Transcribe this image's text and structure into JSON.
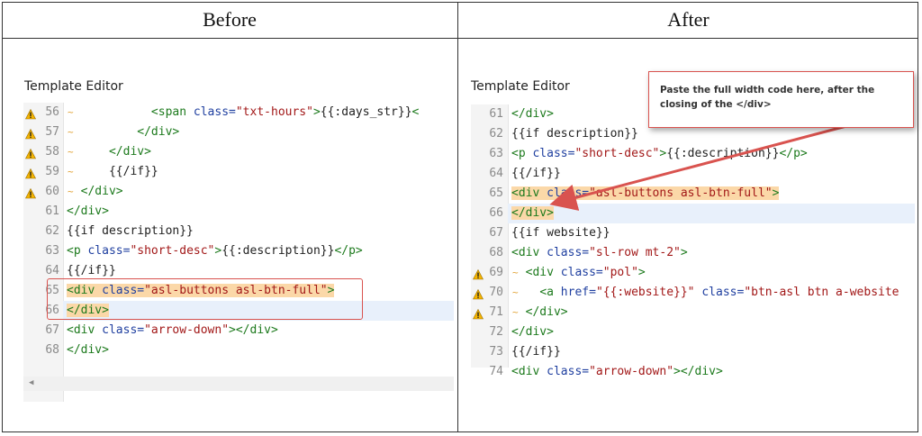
{
  "headers": {
    "before": "Before",
    "after": "After"
  },
  "before": {
    "title": "Template Editor",
    "lines": [
      {
        "num": "56",
        "warn": true,
        "segs": [
          [
            "",
            "            "
          ],
          [
            "tag",
            "<span "
          ],
          [
            "attr",
            "class="
          ],
          [
            "str",
            "\"txt-hours\""
          ],
          [
            "tag",
            ">"
          ],
          [
            "",
            "{{:days_str}}"
          ],
          [
            "tag",
            "<"
          ]
        ]
      },
      {
        "num": "57",
        "warn": true,
        "segs": [
          [
            "",
            "          "
          ],
          [
            "tag",
            "</div>"
          ]
        ]
      },
      {
        "num": "58",
        "warn": true,
        "segs": [
          [
            "",
            "      "
          ],
          [
            "tag",
            "</div>"
          ]
        ]
      },
      {
        "num": "59",
        "warn": true,
        "segs": [
          [
            "",
            "      {{/if}}"
          ]
        ]
      },
      {
        "num": "60",
        "warn": true,
        "segs": [
          [
            "",
            "  "
          ],
          [
            "tag",
            "</div>"
          ]
        ]
      },
      {
        "num": "61",
        "warn": false,
        "segs": [
          [
            "tag",
            "</div>"
          ]
        ]
      },
      {
        "num": "62",
        "warn": false,
        "segs": [
          [
            "",
            "{{if description}}"
          ]
        ]
      },
      {
        "num": "63",
        "warn": false,
        "segs": [
          [
            "tag",
            "<p "
          ],
          [
            "attr",
            "class="
          ],
          [
            "str",
            "\"short-desc\""
          ],
          [
            "tag",
            ">"
          ],
          [
            "",
            "{{:description}}"
          ],
          [
            "tag",
            "</p>"
          ]
        ]
      },
      {
        "num": "64",
        "warn": false,
        "segs": [
          [
            "",
            "{{/if}}"
          ]
        ]
      },
      {
        "num": "65",
        "warn": false,
        "mark": true,
        "segs": [
          [
            "tag",
            "<div "
          ],
          [
            "attr",
            "class="
          ],
          [
            "str",
            "\"asl-buttons asl-btn-full\""
          ],
          [
            "tag",
            ">"
          ]
        ]
      },
      {
        "num": "66",
        "warn": false,
        "mark": true,
        "active": true,
        "segs": [
          [
            "tag",
            "</div>"
          ]
        ]
      },
      {
        "num": "67",
        "warn": false,
        "segs": [
          [
            "tag",
            "<div "
          ],
          [
            "attr",
            "class="
          ],
          [
            "str",
            "\"arrow-down\""
          ],
          [
            "tag",
            "></div>"
          ]
        ]
      },
      {
        "num": "68",
        "warn": false,
        "segs": [
          [
            "tag",
            "</div>"
          ]
        ]
      }
    ]
  },
  "after": {
    "title": "Template Editor",
    "callout": "Paste the full width code here, after the closing of the </div>",
    "lines": [
      {
        "num": "61",
        "warn": false,
        "segs": [
          [
            "tag",
            "</div>"
          ]
        ]
      },
      {
        "num": "62",
        "warn": false,
        "segs": [
          [
            "",
            "{{if description}}"
          ]
        ]
      },
      {
        "num": "63",
        "warn": false,
        "segs": [
          [
            "tag",
            "<p "
          ],
          [
            "attr",
            "class="
          ],
          [
            "str",
            "\"short-desc\""
          ],
          [
            "tag",
            ">"
          ],
          [
            "",
            "{{:description}}"
          ],
          [
            "tag",
            "</p>"
          ]
        ]
      },
      {
        "num": "64",
        "warn": false,
        "segs": [
          [
            "",
            "{{/if}}"
          ]
        ]
      },
      {
        "num": "65",
        "warn": false,
        "mark": true,
        "segs": [
          [
            "tag",
            "<div "
          ],
          [
            "attr",
            "class="
          ],
          [
            "str",
            "\"asl-buttons asl-btn-full\""
          ],
          [
            "tag",
            ">"
          ]
        ]
      },
      {
        "num": "66",
        "warn": false,
        "mark": true,
        "active": true,
        "segs": [
          [
            "tag",
            "</div>"
          ]
        ]
      },
      {
        "num": "67",
        "warn": false,
        "segs": [
          [
            "",
            "{{if website}}"
          ]
        ]
      },
      {
        "num": "68",
        "warn": false,
        "segs": [
          [
            "tag",
            "<div "
          ],
          [
            "attr",
            "class="
          ],
          [
            "str",
            "\"sl-row mt-2\""
          ],
          [
            "tag",
            ">"
          ]
        ]
      },
      {
        "num": "69",
        "warn": true,
        "segs": [
          [
            "",
            "  "
          ],
          [
            "tag",
            "<div "
          ],
          [
            "attr",
            "class="
          ],
          [
            "str",
            "\"pol\""
          ],
          [
            "tag",
            ">"
          ]
        ]
      },
      {
        "num": "70",
        "warn": true,
        "segs": [
          [
            "",
            "    "
          ],
          [
            "tag",
            "<a "
          ],
          [
            "attr",
            "href="
          ],
          [
            "str",
            "\"{{:website}}\""
          ],
          [
            "",
            " "
          ],
          [
            "attr",
            "class="
          ],
          [
            "str",
            "\"btn-asl btn a-website "
          ]
        ]
      },
      {
        "num": "71",
        "warn": true,
        "segs": [
          [
            "",
            "  "
          ],
          [
            "tag",
            "</div>"
          ]
        ]
      },
      {
        "num": "72",
        "warn": false,
        "segs": [
          [
            "tag",
            "</div>"
          ]
        ]
      },
      {
        "num": "73",
        "warn": false,
        "segs": [
          [
            "",
            "{{/if}}"
          ]
        ]
      },
      {
        "num": "74",
        "warn": false,
        "segs": [
          [
            "tag",
            "<div "
          ],
          [
            "attr",
            "class="
          ],
          [
            "str",
            "\"arrow-down\""
          ],
          [
            "tag",
            "></div>"
          ]
        ]
      }
    ]
  },
  "colors": {
    "tag": "#1d7a1d",
    "attr": "#2040a0",
    "string": "#a21818",
    "highlight": "#fbd8a8",
    "annotation": "#d9534f"
  },
  "icons": {
    "warning": "warning-icon",
    "fold": "fold-marker-icon",
    "scroll": "scroll-left-icon"
  }
}
